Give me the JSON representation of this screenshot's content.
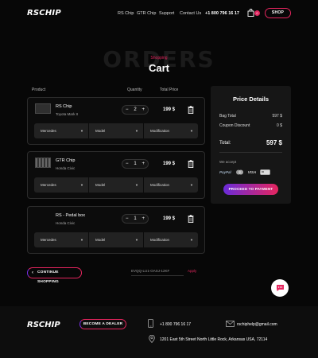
{
  "header": {
    "logo": "RSCHIP",
    "nav": [
      "RS Chip",
      "GTR Chip",
      "Support",
      "Contact Us"
    ],
    "phone": "+1 800 796 16 17",
    "cart_count": "0",
    "shop_label": "SHOP"
  },
  "title": {
    "background_word": "ORDERS",
    "breadcrumb": "Shopping",
    "heading": "Cart"
  },
  "columns": {
    "product": "Product",
    "quantity": "Quantity",
    "total_price": "Total Price"
  },
  "products": [
    {
      "name": "RS Chip",
      "subtitle": "Toyota Mark II",
      "qty": "2",
      "price": "199 $",
      "make": "Mercedes",
      "model": "Model",
      "modification": "Modification"
    },
    {
      "name": "GTR Chip",
      "subtitle": "Honda Civic",
      "qty": "1",
      "price": "199 $",
      "make": "Mercedes",
      "model": "Model",
      "modification": "Modification"
    },
    {
      "name": "RS - Pedal box",
      "subtitle": "Honda Civic",
      "qty": "1",
      "price": "199 $",
      "make": "Mercedes",
      "model": "Model",
      "modification": "Modification"
    }
  ],
  "qty_controls": {
    "minus": "−",
    "plus": "+"
  },
  "price_details": {
    "title": "Price Details",
    "bag_total_label": "Bag Total",
    "bag_total_value": "597 $",
    "coupon_label": "Coupon Discount",
    "coupon_value": "0 $",
    "total_label": "Total:",
    "total_value": "597 $",
    "accept_label": "We accept",
    "payment_methods": [
      "PayPal",
      "",
      "VISA",
      ""
    ],
    "proceed_label": "PROCEED TO PAYMENT"
  },
  "actions": {
    "continue_label": "CONTINUE SHOPPING",
    "coupon_code": "EVQQ-LU1-OASJ-12KF",
    "apply_label": "Apply"
  },
  "footer": {
    "logo": "RSCHIP",
    "dealer_label": "BECOME A DEALER",
    "phone": "+1 800 796 16 17",
    "email": "rschiphelp@gmail.com",
    "address": "1201 East 5th Street North Little Rock, Arkansas USA, 72114"
  },
  "colors": {
    "accent": "#e5255e",
    "accent_purple": "#7b2ee6",
    "background": "#070707",
    "panel": "#161616"
  }
}
